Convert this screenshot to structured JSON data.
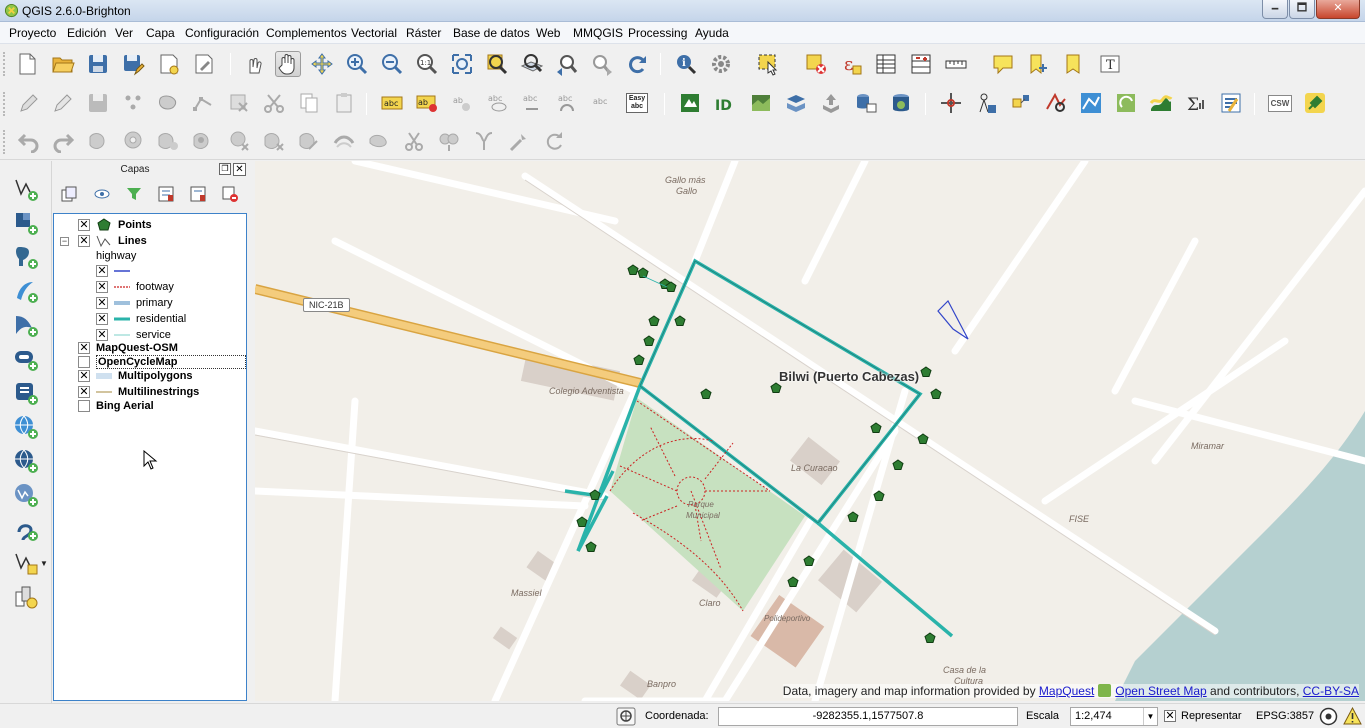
{
  "window": {
    "title": "QGIS 2.6.0-Brighton",
    "minimize": "🗕",
    "maximize": "🗖",
    "close": "✕"
  },
  "menu": [
    "Proyecto",
    "Edición",
    "Ver",
    "Capa",
    "Configuración",
    "Complementos",
    "Vectorial",
    "Ráster",
    "Base de datos",
    "Web",
    "MMQGIS",
    "Processing",
    "Ayuda"
  ],
  "toolbar_icons": {
    "row1": [
      "new-project-icon",
      "open-project-icon",
      "save-project-icon",
      "save-as-icon",
      "new-print-composer-icon",
      "composer-manager-icon",
      "touch-zoom-icon",
      "pan-hand-icon",
      "pan-to-selection-icon",
      "zoom-in-icon",
      "zoom-out-icon",
      "zoom-native-icon",
      "zoom-full-icon",
      "zoom-to-selection-icon",
      "zoom-to-layer-icon",
      "zoom-last-icon",
      "zoom-next-icon",
      "refresh-icon",
      "identify-icon",
      "action-gear-icon",
      "select-features-icon",
      "deselect-icon",
      "expression-select-icon",
      "attribute-table-icon",
      "field-calculator-icon",
      "measure-line-icon",
      "map-tips-icon",
      "new-bookmark-icon",
      "show-bookmarks-icon",
      "text-annotation-icon"
    ],
    "row2": [
      "current-edits-icon",
      "toggle-editing-icon",
      "save-edits-icon",
      "add-feature-icon",
      "move-feature-icon",
      "node-tool-icon",
      "delete-selected-icon",
      "cut-features-icon",
      "copy-features-icon",
      "paste-features-icon",
      "layer-labeling-icon",
      "label-pin-icon",
      "label-highlight-icon",
      "label-show-hide-icon",
      "label-move-icon",
      "label-rotate-icon",
      "label-change-icon",
      "qgis2web-icon",
      "hide-icon",
      "raster-import-icon",
      "shp-to-postgis-icon",
      "upload-icon",
      "db-manager-icon",
      "postgis-icon",
      "georeferencer-icon",
      "coordinate-capture-icon",
      "gps-tool-icon",
      "spatial-query-icon",
      "topology-checker-icon",
      "road-graph-icon",
      "heatmap-icon",
      "statistics-sum-icon",
      "metadata-icon",
      "csw-icon",
      "plugin-icon"
    ],
    "row3": [
      "undo-icon",
      "redo-icon",
      "simplify-feature-icon",
      "add-ring-icon",
      "add-part-icon",
      "fill-ring-icon",
      "delete-ring-icon",
      "delete-part-icon",
      "reshape-features-icon",
      "offset-curve-icon",
      "split-features-icon",
      "split-parts-icon",
      "merge-selected-icon",
      "merge-attributes-icon",
      "rotate-point-symbols-icon"
    ],
    "easy_label": "Easy\nabc",
    "csw_label": "CSW"
  },
  "left_dock_icons": [
    "add-vector-layer-icon",
    "add-raster-layer-icon",
    "add-postgis-layer-icon",
    "add-spatialite-layer-icon",
    "add-mssql-layer-icon",
    "add-oracle-layer-icon",
    "add-db2-layer-icon",
    "add-wms-layer-icon",
    "add-wcs-layer-icon",
    "add-wfs-layer-icon",
    "add-delimited-text-icon",
    "new-shapefile-icon",
    "add-virtual-layer-icon"
  ],
  "layers_panel": {
    "title": "Capas",
    "tools": [
      "add-group-icon",
      "manage-visibility-icon",
      "filter-legend-icon",
      "expand-all-icon",
      "collapse-all-icon",
      "remove-layer-icon"
    ],
    "layers": [
      {
        "name": "Points",
        "checked": true
      },
      {
        "name": "Lines",
        "checked": true,
        "classified_by": "highway",
        "classes": [
          {
            "label": "",
            "checked": true
          },
          {
            "label": "footway",
            "checked": true
          },
          {
            "label": "primary",
            "checked": true
          },
          {
            "label": "residential",
            "checked": true
          },
          {
            "label": "service",
            "checked": true
          }
        ]
      },
      {
        "name": "MapQuest-OSM",
        "checked": true
      },
      {
        "name": "OpenCycleMap",
        "checked": false,
        "selected": true
      },
      {
        "name": "Multipolygons",
        "checked": true
      },
      {
        "name": "Multilinestrings",
        "checked": true
      },
      {
        "name": "Bing Aerial",
        "checked": false
      }
    ]
  },
  "map": {
    "place_title": "Bilwi (Puerto Cabezas)",
    "road_ref": "NIC-21B",
    "labels": [
      "Gallo más",
      "Gallo",
      "Colegio Adventista",
      "Miramar",
      "La Curacao",
      "FISE",
      "Parque",
      "Municipal",
      "Massiel",
      "Claro",
      "Polideportivo",
      "Casa de la",
      "Cultura",
      "Banpro"
    ],
    "colors": {
      "background": "#f2efe9",
      "water": "#b5d0d0",
      "park": "#c7e1c0",
      "primary_road": "#f1c46b",
      "residential": "#2ab3aa",
      "footway": "#cc2222",
      "point_fill": "#2e7d32"
    },
    "attribution": {
      "prefix": "Data, imagery and map information provided by",
      "mapquest": "MapQuest",
      "osm": "Open Street Map",
      "and": "and contributors,",
      "license": "CC-BY-SA"
    }
  },
  "statusbar": {
    "coord_label": "Coordenada:",
    "coord_value": "-9282355.1,1577507.8",
    "scale_label": "Escala",
    "scale_value": "1:2,474",
    "render_label": "Representar",
    "render_checked": true,
    "epsg": "EPSG:3857"
  }
}
